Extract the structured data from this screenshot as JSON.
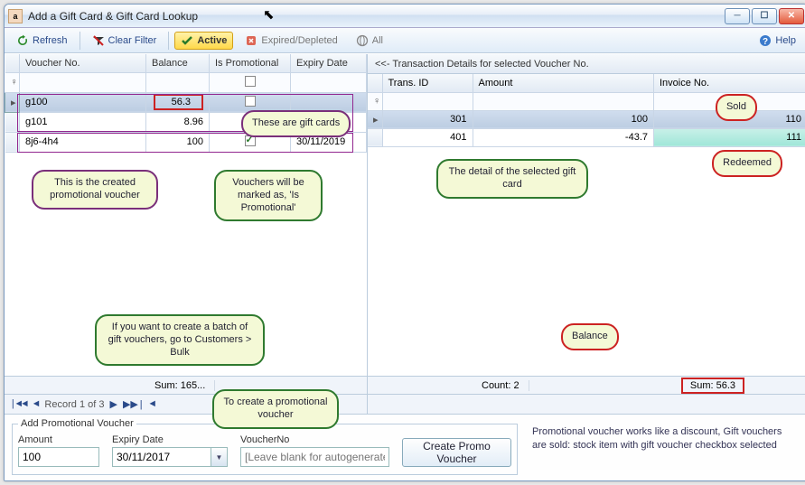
{
  "window": {
    "title": "Add a Gift Card & Gift Card Lookup"
  },
  "toolbar": {
    "refresh": "Refresh",
    "clear_filter": "Clear Filter",
    "active": "Active",
    "expired": "Expired/Depleted",
    "all": "All",
    "help": "Help"
  },
  "left": {
    "columns": {
      "voucher": "Voucher No.",
      "balance": "Balance",
      "promo": "Is Promotional",
      "expiry": "Expiry Date"
    },
    "rows": [
      {
        "voucher": "g100",
        "balance": "56.3",
        "promo": false,
        "expiry": ""
      },
      {
        "voucher": "g101",
        "balance": "8.96",
        "promo": false,
        "expiry": ""
      },
      {
        "voucher": "8j6-4h4",
        "balance": "100",
        "promo": true,
        "expiry": "30/11/2019"
      }
    ],
    "sum": "Sum: 165...",
    "nav": "Record 1 of 3"
  },
  "right": {
    "header": "<<- Transaction Details for selected Voucher No.",
    "columns": {
      "tid": "Trans. ID",
      "amount": "Amount",
      "invoice": "Invoice No."
    },
    "rows": [
      {
        "tid": "301",
        "amount": "100",
        "invoice": "110"
      },
      {
        "tid": "401",
        "amount": "-43.7",
        "invoice": "111"
      }
    ],
    "count": "Count: 2",
    "sum": "Sum: 56.3"
  },
  "callouts": {
    "c1": "These are gift cards",
    "c2": "This is the created promotional voucher",
    "c3": "Vouchers will be marked as, 'Is Promotional'",
    "c4": "If you want to create a batch of gift vouchers, go to Customers > Bulk",
    "c5": "To create a promotional voucher",
    "c6": "The detail of the selected gift card",
    "c7": "Balance",
    "sold": "Sold",
    "redeemed": "Redeemed"
  },
  "bottom": {
    "group": "Add Promotional Voucher",
    "amount_label": "Amount",
    "amount_value": "100",
    "expiry_label": "Expiry Date",
    "expiry_value": "30/11/2017",
    "voucherno_label": "VoucherNo",
    "voucherno_placeholder": "[Leave blank for autogenerated]",
    "create_btn": "Create Promo Voucher",
    "help": "Promotional voucher works like a discount, Gift vouchers are sold: stock item with gift voucher checkbox selected"
  }
}
